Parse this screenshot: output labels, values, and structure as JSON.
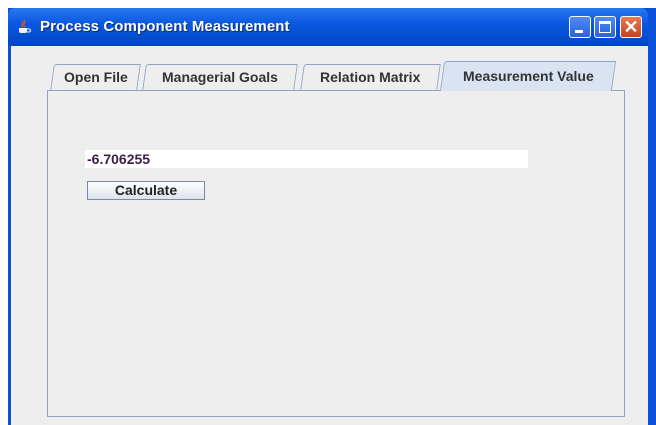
{
  "window": {
    "title": "Process Component Measurement",
    "icon": "java-cup-icon",
    "controls": {
      "minimize": "minimize-icon",
      "maximize": "maximize-icon",
      "close": "✕"
    }
  },
  "tabs": [
    {
      "label": "Open File",
      "selected": false
    },
    {
      "label": "Managerial Goals",
      "selected": false
    },
    {
      "label": "Relation Matrix",
      "selected": false
    },
    {
      "label": "Measurement Value",
      "selected": true
    }
  ],
  "panel": {
    "value_field": "-6.706255",
    "calculate_label": "Calculate"
  },
  "colors": {
    "titlebar": "#0a58e0",
    "close_button": "#c9401e",
    "selected_tab": "#d9e3f2",
    "value_text": "#3b1e44"
  }
}
